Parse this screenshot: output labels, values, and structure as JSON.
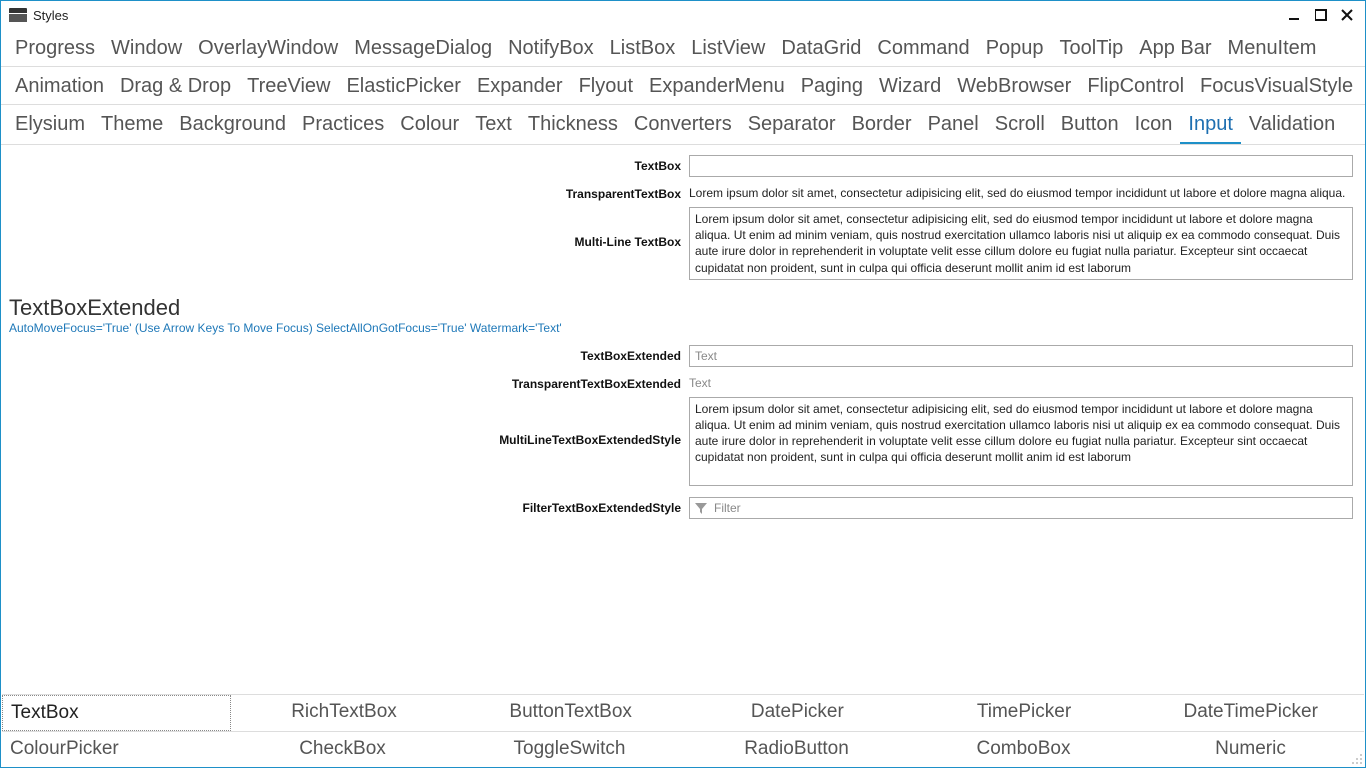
{
  "window": {
    "title": "Styles"
  },
  "top_tabs_row1": [
    "Progress",
    "Window",
    "OverlayWindow",
    "MessageDialog",
    "NotifyBox",
    "ListBox",
    "ListView",
    "DataGrid",
    "Command",
    "Popup",
    "ToolTip",
    "App Bar",
    "MenuItem"
  ],
  "top_tabs_row2": [
    "Animation",
    "Drag & Drop",
    "TreeView",
    "ElasticPicker",
    "Expander",
    "Flyout",
    "ExpanderMenu",
    "Paging",
    "Wizard",
    "WebBrowser",
    "FlipControl",
    "FocusVisualStyle"
  ],
  "top_tabs_row3": [
    "Elysium",
    "Theme",
    "Background",
    "Practices",
    "Colour",
    "Text",
    "Thickness",
    "Converters",
    "Separator",
    "Border",
    "Panel",
    "Scroll",
    "Button",
    "Icon",
    "Input",
    "Validation"
  ],
  "selected_top_tab": "Input",
  "form": {
    "textbox_label": "TextBox",
    "textbox_value": "",
    "transparent_label": "TransparentTextBox",
    "transparent_value": "Lorem ipsum dolor sit amet, consectetur adipisicing elit, sed do eiusmod tempor incididunt ut labore et dolore magna aliqua.",
    "multiline_label": "Multi-Line TextBox",
    "multiline_value": "Lorem ipsum dolor sit amet, consectetur adipisicing elit, sed do eiusmod tempor incididunt ut labore et dolore magna aliqua. Ut enim ad minim veniam, quis nostrud exercitation ullamco laboris nisi ut aliquip ex ea commodo consequat. Duis aute irure dolor in reprehenderit in voluptate velit esse cillum dolore eu fugiat nulla pariatur. Excepteur sint occaecat cupidatat non proident, sunt in culpa qui officia deserunt mollit anim id est laborum"
  },
  "section": {
    "title": "TextBoxExtended",
    "subtitle": "AutoMoveFocus='True' (Use Arrow Keys To Move Focus) SelectAllOnGotFocus='True' Watermark='Text'"
  },
  "ext": {
    "textbox_label": "TextBoxExtended",
    "textbox_placeholder": "Text",
    "transparent_label": "TransparentTextBoxExtended",
    "transparent_placeholder": "Text",
    "multiline_label": "MultiLineTextBoxExtendedStyle",
    "multiline_value": "Lorem ipsum dolor sit amet, consectetur adipisicing elit, sed do eiusmod tempor incididunt ut labore et dolore magna aliqua. Ut enim ad minim veniam, quis nostrud exercitation ullamco laboris nisi ut aliquip ex ea commodo consequat. Duis aute irure dolor in reprehenderit in voluptate velit esse cillum dolore eu fugiat nulla pariatur. Excepteur sint occaecat cupidatat non proident, sunt in culpa qui officia deserunt mollit anim id est laborum",
    "filter_label": "FilterTextBoxExtendedStyle",
    "filter_placeholder": "Filter"
  },
  "bottom_tabs_row1": [
    "TextBox",
    "RichTextBox",
    "ButtonTextBox",
    "DatePicker",
    "TimePicker",
    "DateTimePicker"
  ],
  "bottom_tabs_row2": [
    "ColourPicker",
    "CheckBox",
    "ToggleSwitch",
    "RadioButton",
    "ComboBox",
    "Numeric"
  ],
  "selected_bottom_tab": "TextBox"
}
